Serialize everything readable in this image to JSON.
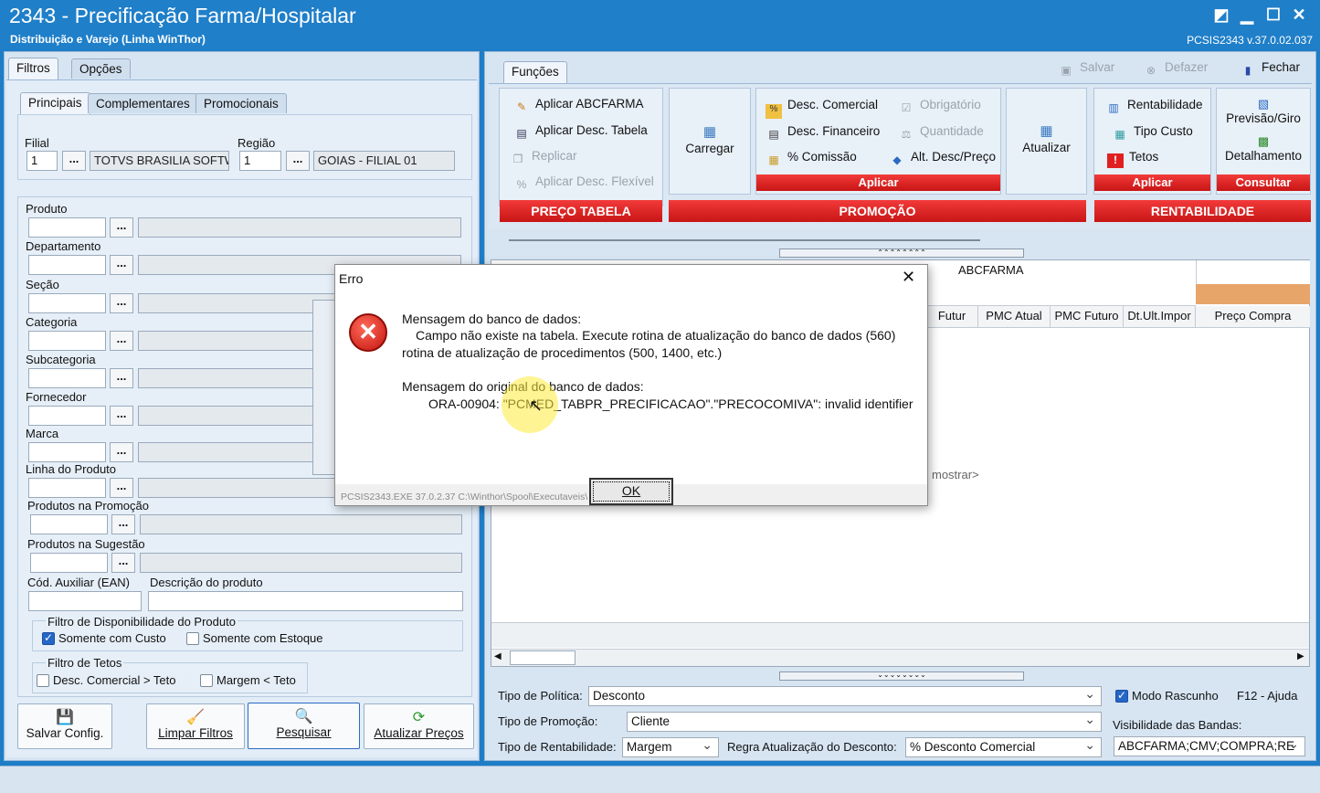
{
  "window": {
    "title": "2343 - Precificação Farma/Hospitalar",
    "subtitle": "Distribuição e Varejo (Linha WinThor)",
    "version": "PCSIS2343  v.37.0.02.037"
  },
  "left_tabs": [
    "Filtros",
    "Opções"
  ],
  "sub_tabs": [
    "Principais",
    "Complementares",
    "Promocionais"
  ],
  "filial": {
    "label": "Filial",
    "code": "1",
    "name": "TOTVS BRASILIA SOFTW"
  },
  "regiao": {
    "label": "Região",
    "code": "1",
    "name": "GOIAS - FILIAL 01"
  },
  "filters": [
    "Produto",
    "Departamento",
    "Seção",
    "Categoria",
    "Subcategoria",
    "Fornecedor",
    "Marca",
    "Linha do Produto",
    "Produtos na Promoção",
    "Produtos na Sugestão"
  ],
  "cod_auxiliar_label": "Cód. Auxiliar (EAN)",
  "descricao_label": "Descrição do produto",
  "disponibilidade": {
    "title": "Filtro de Disponibilidade do Produto",
    "custo": "Somente com Custo",
    "estoque": "Somente com Estoque"
  },
  "tetos": {
    "title": "Filtro de Tetos",
    "desc": "Desc.  Comercial > Teto",
    "margem": "Margem < Teto"
  },
  "buttons": {
    "dots": "...",
    "salvar_config": "Salvar Config.",
    "limpar_filtros": "Limpar Filtros",
    "pesquisar": "Pesquisar",
    "atualizar_precos": "Atualizar Preços"
  },
  "funcoes_tab": "Funções",
  "toolbar": {
    "salvar": "Salvar",
    "desfazer": "Defazer",
    "fechar": "Fechar"
  },
  "ribbon": {
    "preco_tabela": {
      "items": [
        "Aplicar ABCFARMA",
        "Aplicar Desc. Tabela",
        "Replicar",
        "Aplicar Desc. Flexível"
      ],
      "label": "PREÇO TABELA"
    },
    "carregar": "Carregar",
    "promocao": {
      "items": [
        "Desc. Comercial",
        "Desc. Financeiro",
        "% Comissão",
        "Obrigatório",
        "Quantidade",
        "Alt. Desc/Preço"
      ],
      "aplicar": "Aplicar",
      "label": "PROMOÇÃO"
    },
    "atualizar": "Atualizar",
    "rentabilidade": {
      "items": [
        "Rentabilidade",
        "Tipo Custo",
        "Tetos"
      ],
      "aplicar": "Aplicar",
      "consultar_items": [
        "Previsão/Giro",
        "Detalhamento"
      ],
      "consultar": "Consultar",
      "label": "RENTABILIDADE"
    }
  },
  "grid": {
    "band": "ABCFARMA",
    "columns": [
      "Futur",
      "PMC Atual",
      "PMC Futuro",
      "Dt.Ult.Impor",
      "Preço Compra"
    ],
    "empty_hint": "mostrar>"
  },
  "dialog": {
    "title": "Erro",
    "line1": "Mensagem do banco de dados:",
    "line2": "Campo não existe na tabela. Execute rotina de atualização do banco de dados (560)",
    "line3": "rotina de atualização de procedimentos (500, 1400, etc.)",
    "line4": "Mensagem do original do banco de dados:",
    "line5": "ORA-00904: \"PCMED_TABPR_PRECIFICACAO\".\"PRECOCOMIVA\": invalid identifier",
    "ok": "OK",
    "status": "PCSIS2343.EXE 37.0.2.37 C:\\Winthor\\Spool\\Executaveis\\"
  },
  "bottom": {
    "tipo_politica_label": "Tipo de Política:",
    "tipo_politica": "Desconto",
    "tipo_promocao_label": "Tipo de Promoção:",
    "tipo_promocao": "Cliente",
    "tipo_rentabilidade_label": "Tipo de Rentabilidade:",
    "tipo_rentabilidade": "Margem",
    "regra_label": "Regra Atualização do Desconto:",
    "regra": "% Desconto Comercial",
    "modo_rascunho": "Modo Rascunho",
    "ajuda": "F12 - Ajuda",
    "visibilidade_label": "Visibilidade das Bandas:",
    "visibilidade": "ABCFARMA;CMV;COMPRA;RE"
  }
}
